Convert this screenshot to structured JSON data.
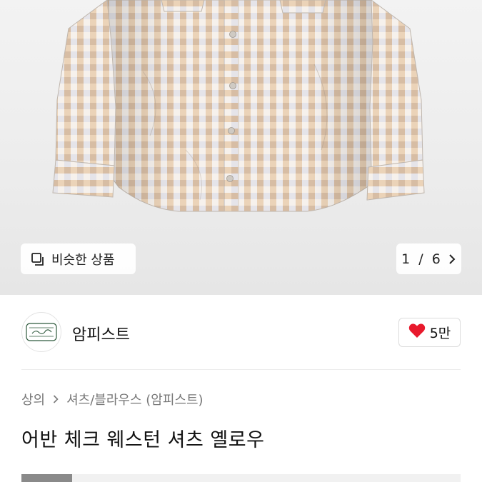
{
  "hero": {
    "similar_label": "비슷한 상품",
    "similar_icon": "similar-products-icon",
    "pager": {
      "current": "1",
      "separator": "/",
      "total": "6"
    }
  },
  "brand": {
    "name": "암피스트",
    "likes": "5만",
    "heart_color": "#e8192c"
  },
  "breadcrumb": {
    "category": "상의",
    "subcategory": "셔츠/블라우스 (암피스트)"
  },
  "product": {
    "title": "어반 체크 웨스턴 셔츠 옐로우"
  }
}
